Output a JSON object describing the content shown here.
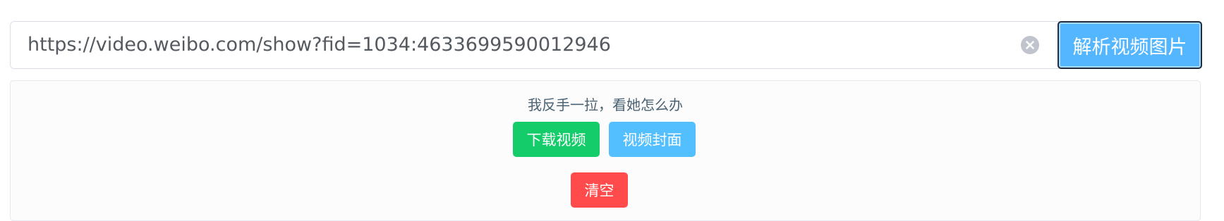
{
  "search": {
    "url_value": "https://video.weibo.com/show?fid=1034:4633699590012946",
    "parse_label": "解析视频图片"
  },
  "result": {
    "title": "我反手一拉，看她怎么办",
    "download_label": "下载视频",
    "cover_label": "视频封面",
    "clear_label": "清空"
  },
  "icons": {
    "clear": "close-circle-icon"
  },
  "colors": {
    "parse_button": "#53b6ff",
    "download_button": "#14cd6a",
    "cover_button": "#53bfff",
    "clear_button": "#ff4b4b",
    "title_text": "#4a6273"
  }
}
